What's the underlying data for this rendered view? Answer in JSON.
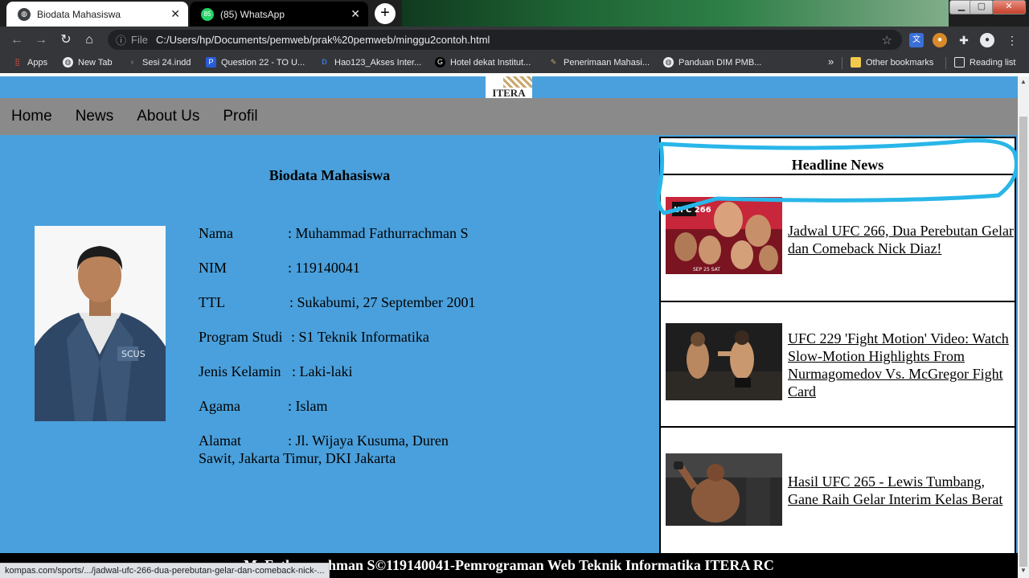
{
  "browser": {
    "tabs": [
      {
        "title": "Biodata Mahasiswa"
      },
      {
        "title": "(85) WhatsApp",
        "badge": "85"
      }
    ],
    "address": {
      "file_label": "File",
      "url": "C:/Users/hp/Documents/pemweb/prak%20pemweb/minggu2contoh.html"
    },
    "bookmarks": [
      {
        "label": "Apps"
      },
      {
        "label": "New Tab"
      },
      {
        "label": "Sesi 24.indd"
      },
      {
        "label": "Question 22 - TO U..."
      },
      {
        "label": "Hao123_Akses Inter..."
      },
      {
        "label": "Hotel dekat Institut..."
      },
      {
        "label": "Penerimaan Mahasi..."
      },
      {
        "label": "Panduan DIM PMB..."
      }
    ],
    "bookmarks_more": "»",
    "other_bookmarks": "Other bookmarks",
    "reading_list": "Reading list",
    "status_url": "kompas.com/sports/.../jadwal-ufc-266-dua-perebutan-gelar-dan-comeback-nick-..."
  },
  "site": {
    "logo_text": "ITERA",
    "nav": [
      "Home",
      "News",
      "About Us",
      "Profil"
    ],
    "bio_title": "Biodata Mahasiswa",
    "bio": [
      {
        "label": "Nama",
        "value": ": Muhammad Fathurrachman S"
      },
      {
        "label": "NIM",
        "value": ": 119140041"
      },
      {
        "label": "TTL",
        "value": ": Sukabumi, 27 September 2001"
      },
      {
        "label": "Program Studi",
        "value": ": S1 Teknik Informatika"
      },
      {
        "label": "Jenis Kelamin",
        "value": ": Laki-laki"
      },
      {
        "label": "Agama",
        "value": ": Islam"
      },
      {
        "label": "Alamat",
        "value": ": Jl. Wijaya Kusuma, Duren",
        "value2": "Sawit, Jakarta Timur, DKI Jakarta"
      }
    ],
    "news_title": "Headline News",
    "news": [
      {
        "headline": "Jadwal UFC 266, Dua Perebutan Gelar dan Comeback Nick Diaz!",
        "thumb_label": "UFC 266",
        "thumb_date": "SEP 25 SAT"
      },
      {
        "headline": "UFC 229 'Fight Motion' Video: Watch Slow-Motion Highlights From Nurmagomedov Vs. McGregor Fight Card"
      },
      {
        "headline": "Hasil UFC 265 - Lewis Tumbang, Gane Raih Gelar Interim Kelas Berat"
      }
    ],
    "footer": "M. Fathurrachman S©119140041-Pemrograman Web Teknik Informatika ITERA RC"
  },
  "colors": {
    "page_bg": "#4aa0dc",
    "nav_bg": "#8a8a8a",
    "highlight": "#29b6e8"
  }
}
